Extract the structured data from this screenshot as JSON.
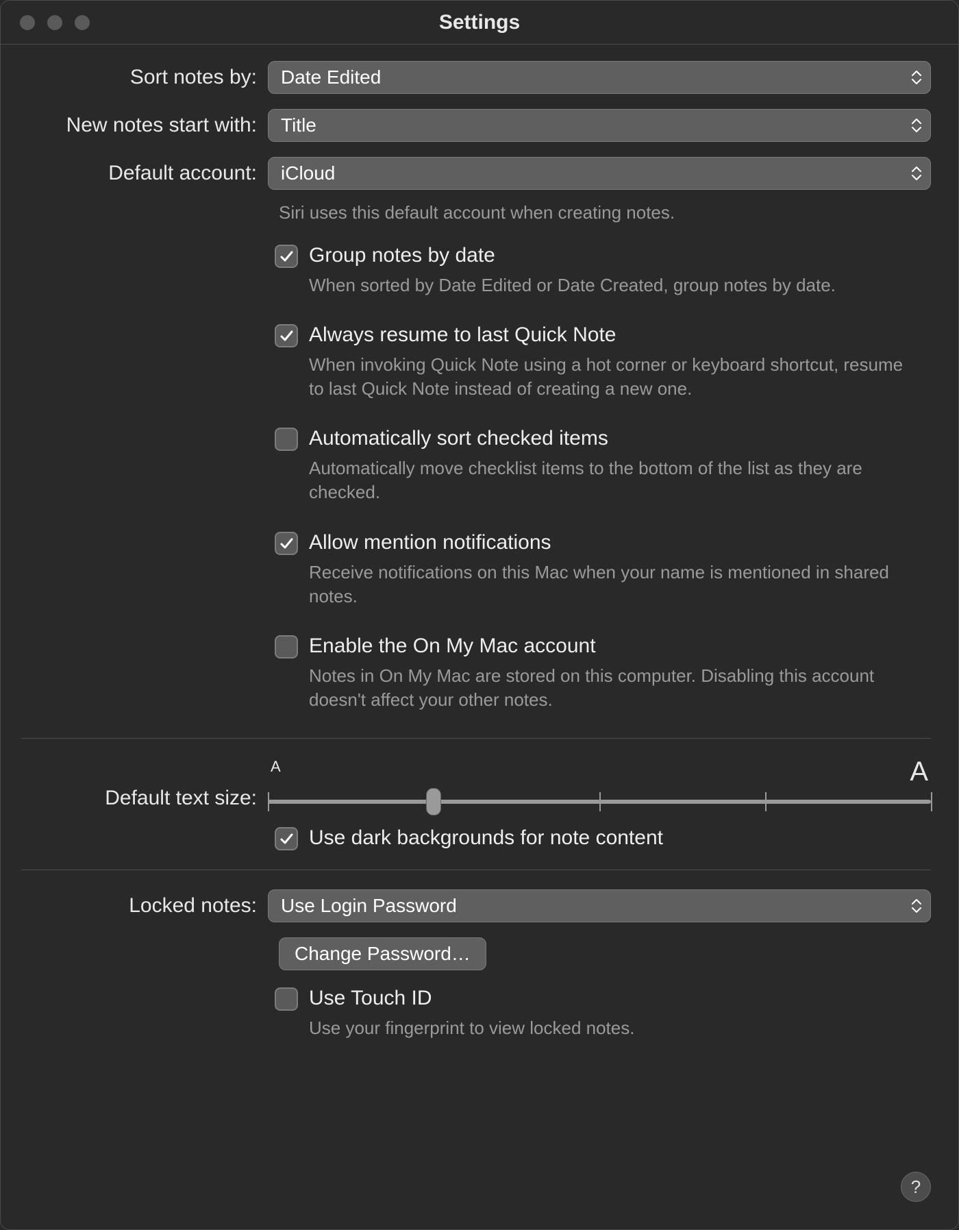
{
  "window": {
    "title": "Settings"
  },
  "labels": {
    "sort_by": "Sort notes by:",
    "new_notes_start": "New notes start with:",
    "default_account": "Default account:",
    "default_text_size": "Default text size:",
    "locked_notes": "Locked notes:"
  },
  "selects": {
    "sort_by": "Date Edited",
    "new_notes_start": "Title",
    "default_account": "iCloud",
    "locked_notes": "Use Login Password"
  },
  "captions": {
    "default_account": "Siri uses this default account when creating notes."
  },
  "checkboxes": {
    "group_by_date": {
      "label": "Group notes by date",
      "desc": "When sorted by Date Edited or Date Created, group notes by date.",
      "checked": true
    },
    "resume_quick_note": {
      "label": "Always resume to last Quick Note",
      "desc": "When invoking Quick Note using a hot corner or keyboard shortcut, resume to last Quick Note instead of creating a new one.",
      "checked": true
    },
    "auto_sort_checked": {
      "label": "Automatically sort checked items",
      "desc": "Automatically move checklist items to the bottom of the list as they are checked.",
      "checked": false
    },
    "mention_notifications": {
      "label": "Allow mention notifications",
      "desc": "Receive notifications on this Mac when your name is mentioned in shared notes.",
      "checked": true
    },
    "on_my_mac": {
      "label": "Enable the On My Mac account",
      "desc": "Notes in On My Mac are stored on this computer. Disabling this account doesn't affect your other notes.",
      "checked": false
    },
    "dark_backgrounds": {
      "label": "Use dark backgrounds for note content",
      "checked": true
    },
    "touch_id": {
      "label": "Use Touch ID",
      "desc": "Use your fingerprint to view locked notes.",
      "checked": false
    }
  },
  "slider": {
    "small_label": "A",
    "big_label": "A",
    "ticks": 5,
    "value_percent": 25
  },
  "buttons": {
    "change_password": "Change Password…",
    "help": "?"
  }
}
